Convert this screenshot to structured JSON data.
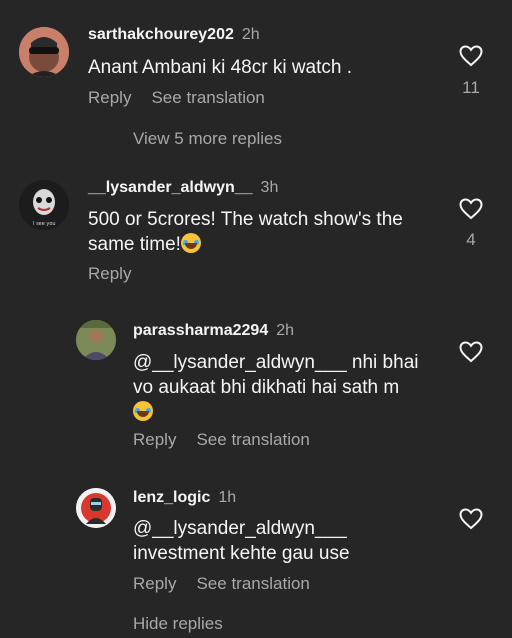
{
  "comments": [
    {
      "username": "sarthakchourey202",
      "time": "2h",
      "text": "Anant Ambani ki 48cr ki watch .",
      "reply_label": "Reply",
      "translate_label": "See translation",
      "likes": "11"
    },
    {
      "username": "__lysander_aldwyn__",
      "time": "3h",
      "text_line1": "500 or 5crores! The watch show's the",
      "text_line2": "same time!",
      "reply_label": "Reply",
      "likes": "4",
      "avatar_caption": "I see you"
    }
  ],
  "view_more_replies": "View 5 more replies",
  "replies": [
    {
      "username": "parassharma2294",
      "time": "2h",
      "text_line1": "@__lysander_aldwyn___ nhi bhai",
      "text_line2": "vo aukaat bhi dikhati hai sath m",
      "reply_label": "Reply",
      "translate_label": "See translation"
    },
    {
      "username": "lenz_logic",
      "time": "1h",
      "text_line1": "@__lysander_aldwyn___",
      "text_line2": "investment kehte gau use",
      "reply_label": "Reply",
      "translate_label": "See translation"
    }
  ],
  "hide_replies": "Hide replies",
  "colors": {
    "background": "#262626",
    "primary_text": "#f5f5f5",
    "secondary_text": "#a8a8a8"
  }
}
